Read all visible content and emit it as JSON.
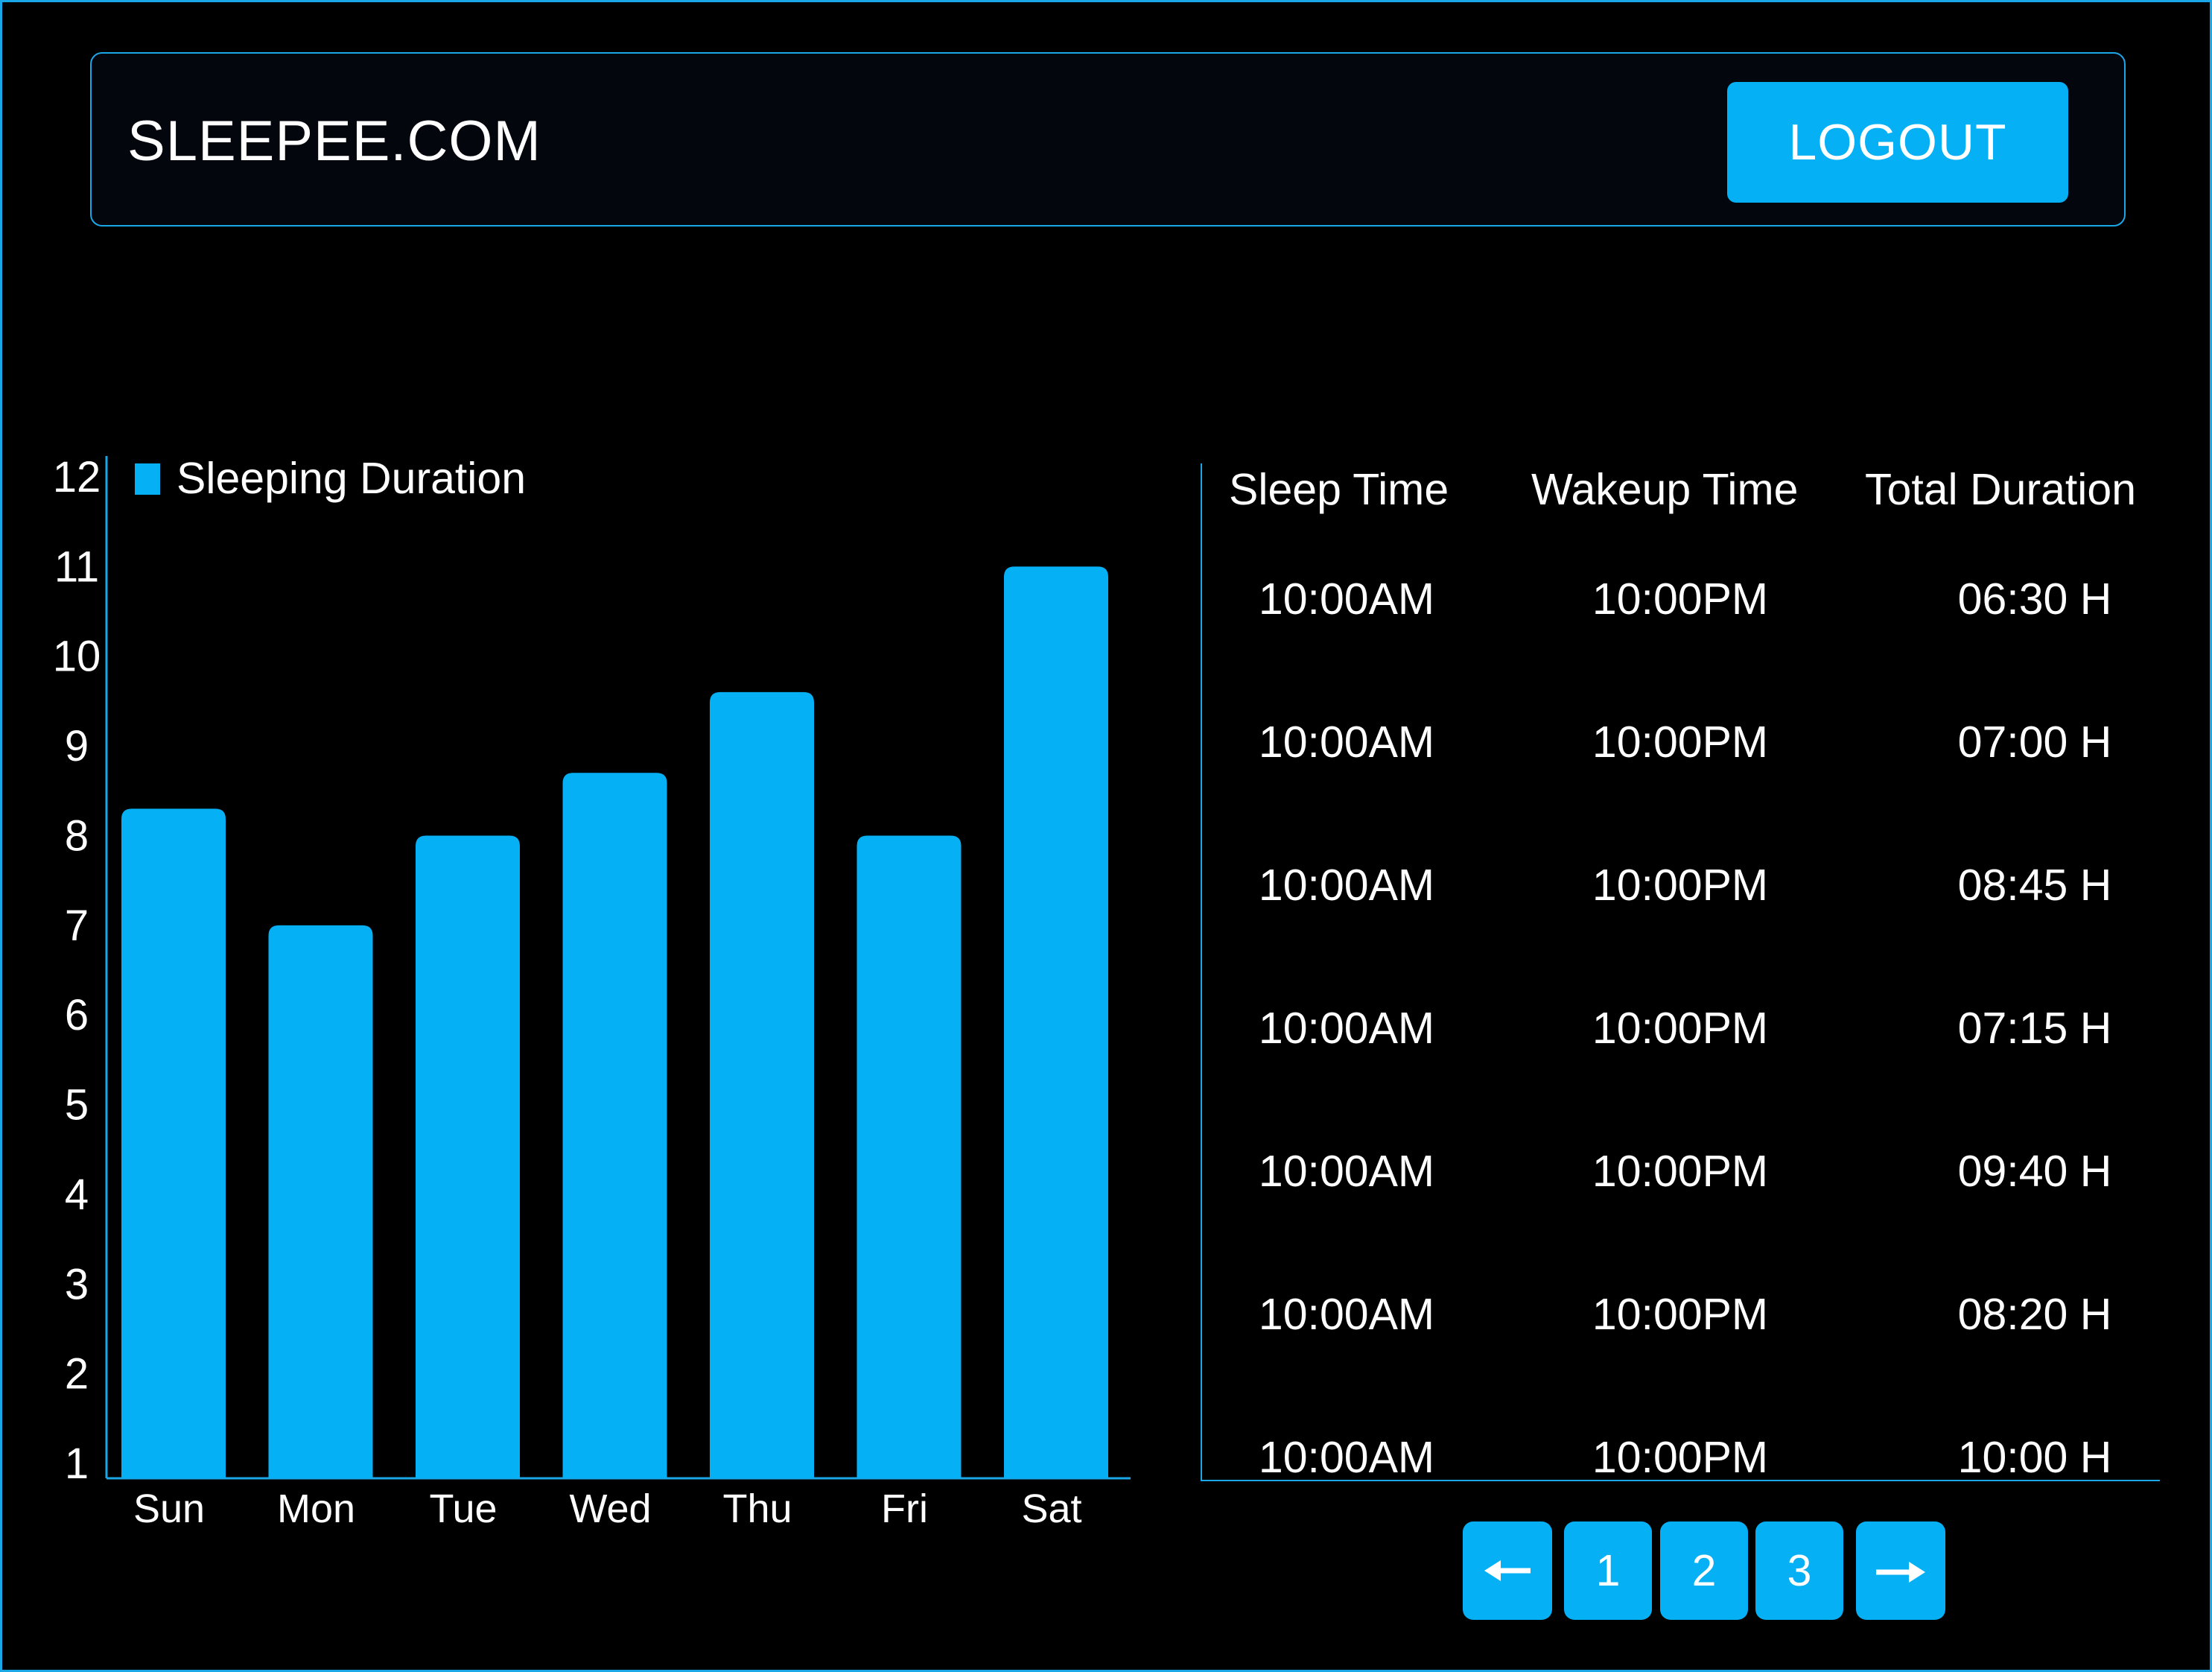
{
  "header": {
    "brand": "SLEEPEE.COM",
    "logout_label": "LOGOUT"
  },
  "colors": {
    "accent": "#05b0f5",
    "border": "#1aa7e8",
    "background": "#000000"
  },
  "chart_data": {
    "type": "bar",
    "categories": [
      "Sun",
      "Mon",
      "Tue",
      "Wed",
      "Thu",
      "Fri",
      "Sat"
    ],
    "series": [
      {
        "name": "Sleeping Duration",
        "values": [
          8.3,
          7.0,
          8.0,
          8.7,
          9.6,
          8.0,
          11.0
        ]
      }
    ],
    "y_ticks": [
      "1",
      "2",
      "3",
      "4",
      "5",
      "6",
      "7",
      "8",
      "9",
      "10",
      "11",
      "12"
    ],
    "ylim": [
      1,
      12
    ],
    "legend": "top-left",
    "grid": false
  },
  "table": {
    "headers": [
      "Sleep Time",
      "Wakeup Time",
      "Total Duration"
    ],
    "rows": [
      [
        "10:00AM",
        "10:00PM",
        "06:30 H"
      ],
      [
        "10:00AM",
        "10:00PM",
        "07:00 H"
      ],
      [
        "10:00AM",
        "10:00PM",
        "08:45 H"
      ],
      [
        "10:00AM",
        "10:00PM",
        "07:15 H"
      ],
      [
        "10:00AM",
        "10:00PM",
        "09:40 H"
      ],
      [
        "10:00AM",
        "10:00PM",
        "08:20 H"
      ],
      [
        "10:00AM",
        "10:00PM",
        "10:00 H"
      ]
    ]
  },
  "pagination": {
    "prev_icon": "arrow-left-icon",
    "pages": [
      "1",
      "2",
      "3"
    ],
    "next_icon": "arrow-right-icon"
  }
}
